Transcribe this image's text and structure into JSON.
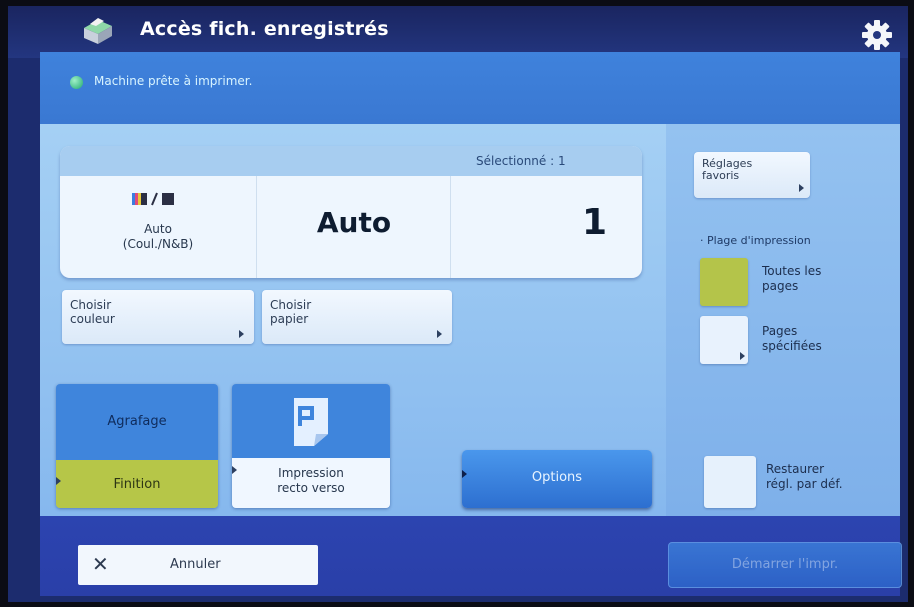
{
  "title_bar": {
    "title": "Accès fich. enregistrés",
    "app_icon": "printer-icon",
    "settings_icon": "gear-icon"
  },
  "status": {
    "text": "Machine prête à imprimer.",
    "indicator_color": "#2fc38a"
  },
  "summary": {
    "selected_text": "Sélectionné : 1",
    "color_mode_icon": "color-bw-icon",
    "color_mode": "Auto\n(Coul./N&B)",
    "paper": "Auto",
    "copies": "1"
  },
  "buttons": {
    "choose_color": "Choisir\ncouleur",
    "choose_paper": "Choisir\npapier",
    "stapling_top": "Agrafage",
    "stapling_bottom": "Finition",
    "duplex": "Impression\nrecto verso",
    "options": "Options"
  },
  "right_panel": {
    "favorites": "Réglages\nfavoris",
    "print_range_title": "Plage d'impression",
    "all_pages": "Toutes les\npages",
    "specified_pages": "Pages\nspécifiées",
    "restore": "Restaurer\nrégl. par déf.",
    "selected_range": "all_pages"
  },
  "footer": {
    "cancel": "Annuler",
    "start": "Démarrer l'impr."
  },
  "colors": {
    "accent_blue": "#3f85dc",
    "selected_green": "#b6c648",
    "panel_light": "#a5d0f4"
  }
}
